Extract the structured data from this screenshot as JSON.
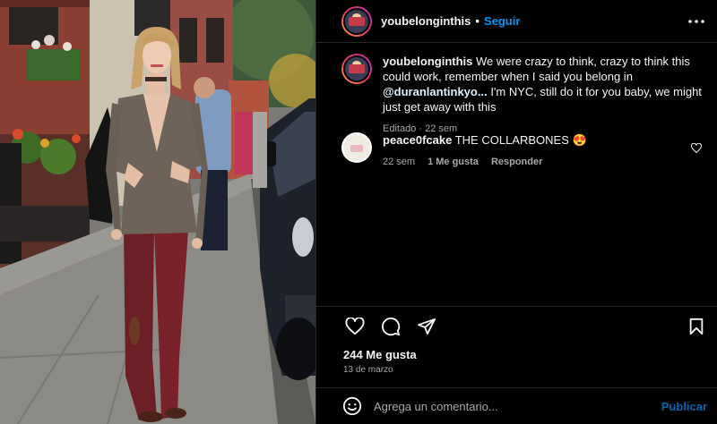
{
  "post": {
    "username": "youbelonginthis",
    "follow_label": "Seguir",
    "separator": "•",
    "caption_text": " We were crazy to think, crazy to think this could work, remember when I said you belong in ",
    "caption_mention": "@duranlantinkyo...",
    "caption_text_after": " I'm NYC, still do it for you baby, we might just get away with this",
    "caption_meta": "Editado · 22 sem",
    "likes": "244 Me gusta",
    "date": "13 de marzo"
  },
  "comments": [
    {
      "username": "peace0fcake",
      "text": " THE COLLARBONES 😍",
      "time": "22 sem",
      "likes": "1 Me gusta",
      "reply_label": "Responder"
    }
  ],
  "composer": {
    "placeholder": "Agrega un comentario...",
    "publish_label": "Publicar"
  },
  "icons": {
    "more": "more-options-icon",
    "like": "heart-icon",
    "comment": "comment-icon",
    "share": "share-icon",
    "save": "bookmark-icon",
    "emoji": "emoji-icon"
  },
  "colors": {
    "accent": "#0095f6",
    "background": "#000000",
    "secondary_text": "#a8a8a8"
  }
}
